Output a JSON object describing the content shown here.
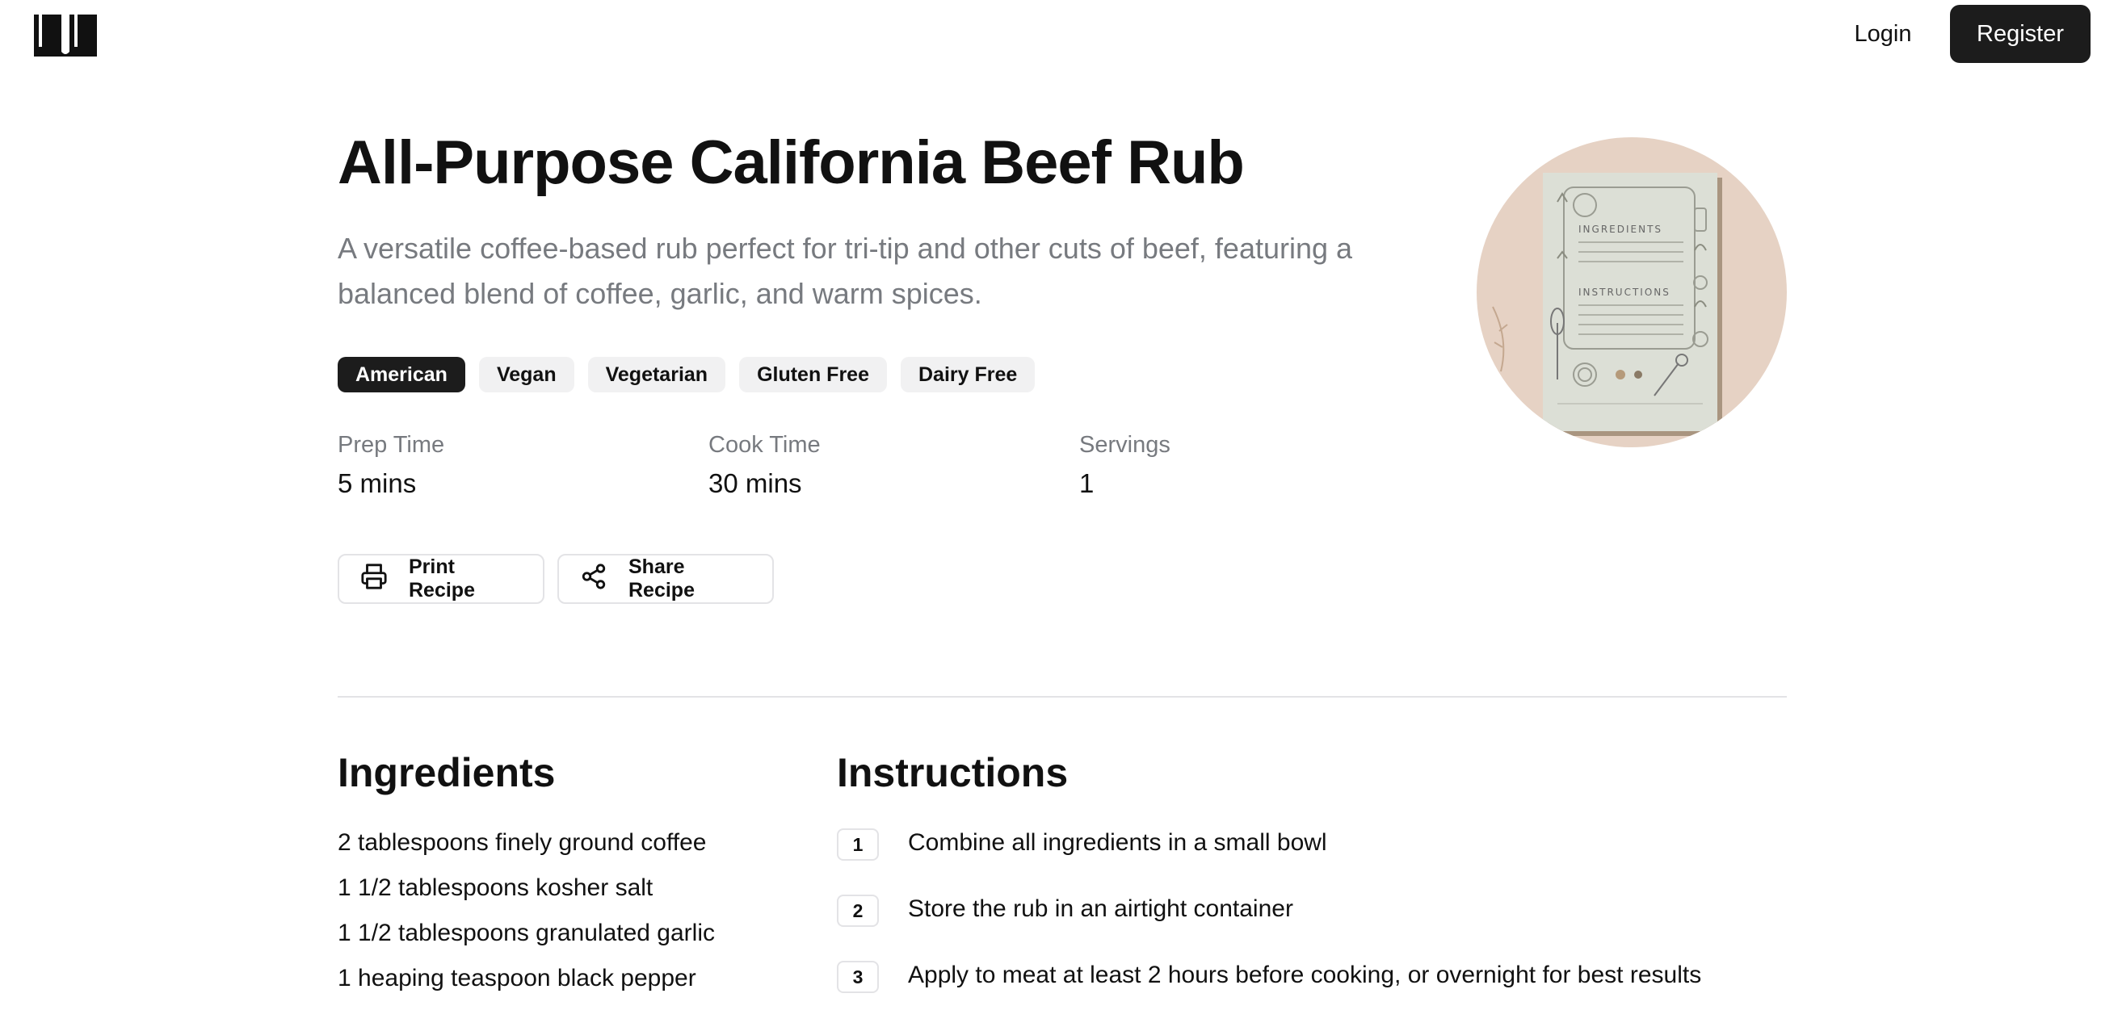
{
  "header": {
    "logo_icon": "open-book-icon",
    "login_label": "Login",
    "register_label": "Register"
  },
  "recipe": {
    "title": "All-Purpose California Beef Rub",
    "description": "A versatile coffee-based rub perfect for tri-tip and other cuts of beef, featuring a balanced blend of coffee, garlic, and warm spices.",
    "tags": [
      {
        "label": "American",
        "active": true
      },
      {
        "label": "Vegan",
        "active": false
      },
      {
        "label": "Vegetarian",
        "active": false
      },
      {
        "label": "Gluten Free",
        "active": false
      },
      {
        "label": "Dairy Free",
        "active": false
      }
    ],
    "meta": {
      "prep_label": "Prep Time",
      "prep_value": "5 mins",
      "cook_label": "Cook Time",
      "cook_value": "30 mins",
      "servings_label": "Servings",
      "servings_value": "1"
    },
    "actions": {
      "print_label": "Print Recipe",
      "print_icon": "printer-icon",
      "share_label": "Share Recipe",
      "share_icon": "share-icon"
    },
    "image_text": {
      "ingredients": "INGREDIENTS",
      "instructions": "INSTRUCTIONS"
    }
  },
  "ingredients": {
    "heading": "Ingredients",
    "items": [
      "2 tablespoons finely ground coffee",
      "1 1/2 tablespoons kosher salt",
      "1 1/2 tablespoons granulated garlic",
      "1 heaping teaspoon black pepper"
    ]
  },
  "instructions": {
    "heading": "Instructions",
    "steps": [
      {
        "num": "1",
        "text": "Combine all ingredients in a small bowl"
      },
      {
        "num": "2",
        "text": "Store the rub in an airtight container"
      },
      {
        "num": "3",
        "text": "Apply to meat at least 2 hours before cooking, or overnight for best results"
      }
    ]
  },
  "colors": {
    "accent_dark": "#1c1c1c",
    "muted_text": "#777a7f",
    "tag_bg": "#f1f1f2",
    "border": "#e3e3e6"
  }
}
